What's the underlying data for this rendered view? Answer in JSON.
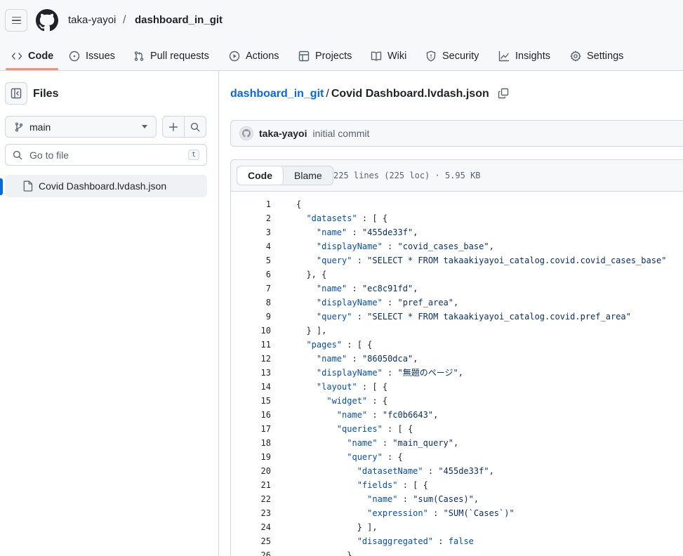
{
  "header": {
    "owner": "taka-yayoi",
    "separator": "/",
    "repo": "dashboard_in_git"
  },
  "tabs": [
    {
      "label": "Code",
      "icon": "code-icon"
    },
    {
      "label": "Issues",
      "icon": "issue-icon"
    },
    {
      "label": "Pull requests",
      "icon": "pull-request-icon"
    },
    {
      "label": "Actions",
      "icon": "play-icon"
    },
    {
      "label": "Projects",
      "icon": "table-icon"
    },
    {
      "label": "Wiki",
      "icon": "book-icon"
    },
    {
      "label": "Security",
      "icon": "shield-icon"
    },
    {
      "label": "Insights",
      "icon": "graph-icon"
    },
    {
      "label": "Settings",
      "icon": "gear-icon"
    }
  ],
  "sidebar": {
    "title": "Files",
    "branch": "main",
    "goto_placeholder": "Go to file",
    "goto_shortcut": "t",
    "files": [
      "Covid Dashboard.lvdash.json"
    ]
  },
  "main": {
    "path_repo": "dashboard_in_git",
    "path_sep": "/",
    "path_file": "Covid Dashboard.lvdash.json",
    "commit_author": "taka-yayoi",
    "commit_message": "initial commit",
    "view_code": "Code",
    "view_blame": "Blame",
    "file_meta": "225 lines (225 loc) · 5.95 KB"
  },
  "colors": {
    "accent": "#0969da",
    "tab_underline": "#fd8c73",
    "json_key": "#0550ae",
    "json_string": "#0a3069"
  },
  "code": [
    "{",
    "  \"datasets\" : [ {",
    "    \"name\" : \"455de33f\",",
    "    \"displayName\" : \"covid_cases_base\",",
    "    \"query\" : \"SELECT * FROM takaakiyayoi_catalog.covid.covid_cases_base\"",
    "  }, {",
    "    \"name\" : \"ec8c91fd\",",
    "    \"displayName\" : \"pref_area\",",
    "    \"query\" : \"SELECT * FROM takaakiyayoi_catalog.covid.pref_area\"",
    "  } ],",
    "  \"pages\" : [ {",
    "    \"name\" : \"86050dca\",",
    "    \"displayName\" : \"無題のページ\",",
    "    \"layout\" : [ {",
    "      \"widget\" : {",
    "        \"name\" : \"fc0b6643\",",
    "        \"queries\" : [ {",
    "          \"name\" : \"main_query\",",
    "          \"query\" : {",
    "            \"datasetName\" : \"455de33f\",",
    "            \"fields\" : [ {",
    "              \"name\" : \"sum(Cases)\",",
    "              \"expression\" : \"SUM(`Cases`)\"",
    "            } ],",
    "            \"disaggregated\" : false",
    "          },"
  ]
}
